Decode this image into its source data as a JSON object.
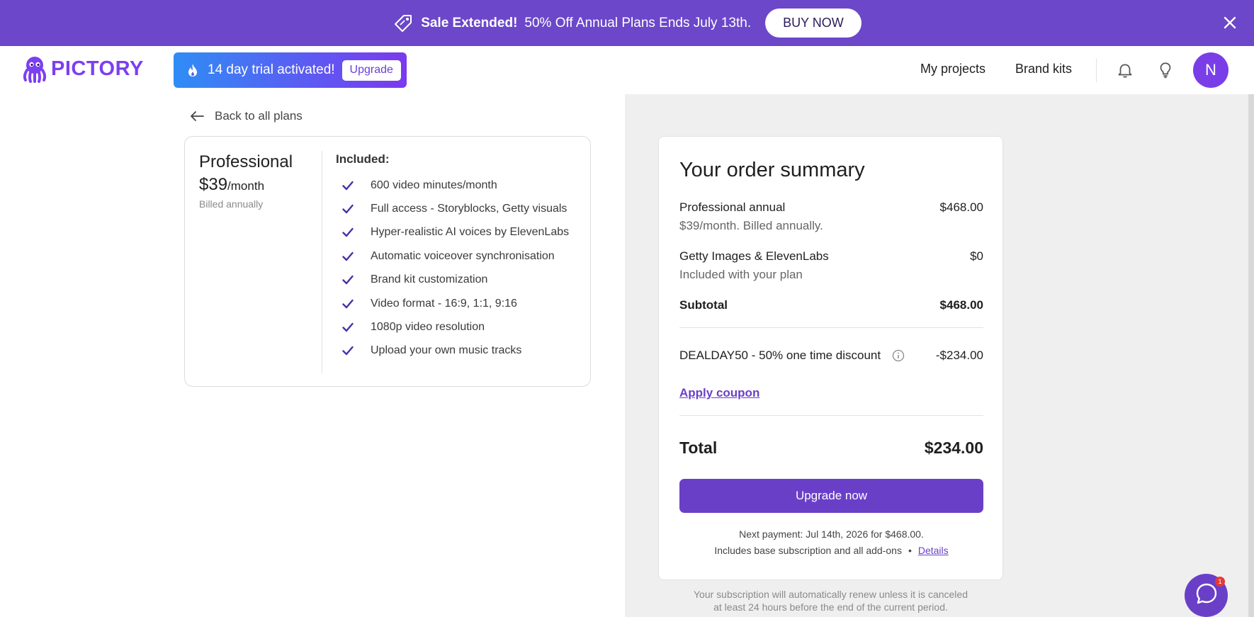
{
  "promo": {
    "strong": "Sale Extended!",
    "message": "50% Off Annual Plans Ends July 13th.",
    "button": "BUY NOW",
    "icons": {
      "tag": "tag-icon",
      "close": "close-icon"
    }
  },
  "header": {
    "logo": "PICTORY",
    "trial": {
      "text": "14 day trial activated!",
      "button": "Upgrade"
    },
    "nav": [
      "My projects",
      "Brand kits"
    ],
    "avatar_initial": "N",
    "icons": {
      "bell": "bell-icon",
      "bulb": "lightbulb-icon"
    }
  },
  "plan": {
    "back_label": "Back to all plans",
    "name": "Professional",
    "price": "$39",
    "per": "/month",
    "billed": "Billed annually",
    "included_title": "Included:",
    "features": [
      "600 video minutes/month",
      "Full access - Storyblocks, Getty visuals",
      "Hyper-realistic AI voices by ElevenLabs",
      "Automatic voiceover synchronisation",
      "Brand kit customization",
      "Video format - 16:9, 1:1, 9:16",
      "1080p video resolution",
      "Upload your own music tracks"
    ]
  },
  "summary": {
    "title": "Your order summary",
    "items": [
      {
        "label": "Professional annual",
        "sub": "$39/month. Billed annually.",
        "amount": "$468.00"
      },
      {
        "label": "Getty Images & ElevenLabs",
        "sub": "Included with your plan",
        "amount": "$0"
      }
    ],
    "subtotal_label": "Subtotal",
    "subtotal_amount": "$468.00",
    "discount_label": "DEALDAY50 - 50% one time discount",
    "discount_amount": "-$234.00",
    "coupon_link": "Apply coupon",
    "total_label": "Total",
    "total_amount": "$234.00",
    "upgrade_button": "Upgrade now",
    "next_payment": "Next payment: Jul 14th, 2026 for $468.00.",
    "includes": "Includes base subscription and all add-ons",
    "details_link": "Details",
    "renew_line1": "Your subscription will automatically renew unless it is canceled",
    "renew_line2": "at least 24 hours before the end of the current period."
  },
  "chat": {
    "badge": "1"
  },
  "colors": {
    "brand": "#6a3fc8",
    "banner": "#6c47c9",
    "logo": "#7b3ff2"
  }
}
